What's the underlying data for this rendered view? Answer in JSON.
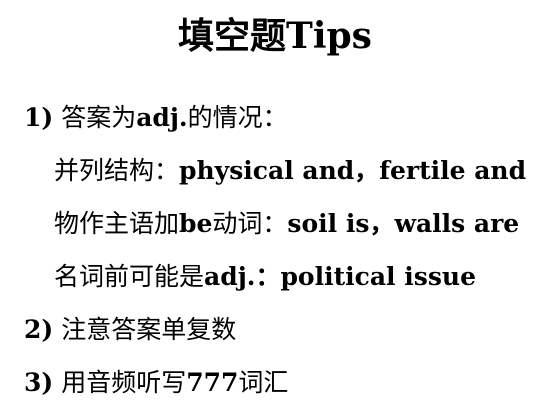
{
  "title": "填空题Tips",
  "items": [
    {
      "num": "1)",
      "prefix": "答案为",
      "bold": "adj.",
      "suffix": "的情况："
    },
    {
      "prefix": "并列结构：",
      "bold": "physical and，fertile and"
    },
    {
      "prefix": "物作主语加",
      "bold": "be",
      "mid": "动词：",
      "bold2": "soil is，walls are"
    },
    {
      "prefix": "名词前可能是",
      "bold": "adj.：political issue"
    },
    {
      "num": "2)",
      "prefix": "注意答案单复数"
    },
    {
      "num": "3)",
      "prefix": "用音频听写",
      "bold": "777",
      "suffix": "词汇"
    }
  ]
}
